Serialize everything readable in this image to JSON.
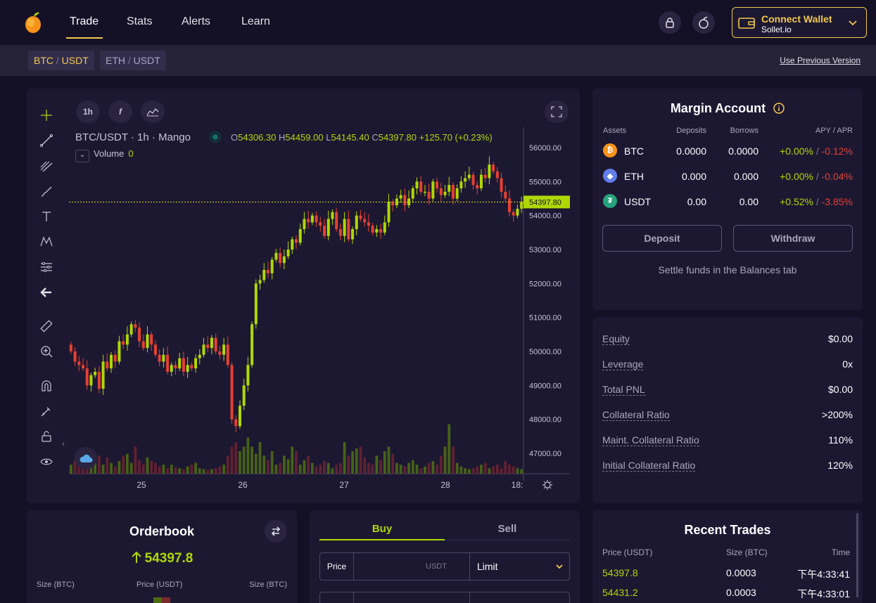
{
  "nav": {
    "items": [
      {
        "label": "Trade",
        "active": true
      },
      {
        "label": "Stats",
        "active": false
      },
      {
        "label": "Alerts",
        "active": false
      },
      {
        "label": "Learn",
        "active": false
      }
    ],
    "wallet": {
      "title": "Connect Wallet",
      "provider": "Sollet.io"
    }
  },
  "markets": {
    "tabs": [
      {
        "base": "BTC",
        "sep": "/",
        "quote": "USDT",
        "active": true
      },
      {
        "base": "ETH",
        "sep": "/",
        "quote": "USDT",
        "active": false
      }
    ],
    "previous_version": "Use Previous Version"
  },
  "chart": {
    "interval_chip": "1h",
    "fx_chip": "f",
    "header": "BTC/USDT · 1h · Mango",
    "ohlc": {
      "o_label": "O",
      "o": "54306.30",
      "h_label": "H",
      "h": "54459.00",
      "l_label": "L",
      "l": "54145.40",
      "c_label": "C",
      "c": "54397.80",
      "change": "+125.70 (+0.23%)"
    },
    "volume_label": "Volume",
    "volume_value": "0",
    "current_price_label": "54397.80",
    "colors": {
      "up": "#afd803",
      "down": "#e54033",
      "bg": "#1d1832"
    }
  },
  "chart_data": {
    "type": "candlestick",
    "x_ticks": [
      "25",
      "26",
      "27",
      "28",
      "18:"
    ],
    "y_ticks": [
      "56000.00",
      "55000.00",
      "54000.00",
      "53000.00",
      "52000.00",
      "51000.00",
      "50000.00",
      "49000.00",
      "48000.00",
      "47000.00"
    ],
    "ylim": [
      46400,
      56600
    ],
    "current_price": 54397.8,
    "closes": [
      50000,
      49700,
      49600,
      49500,
      49000,
      49300,
      49400,
      48900,
      49700,
      49500,
      49900,
      49700,
      50300,
      50200,
      50500,
      50800,
      50700,
      50300,
      50100,
      50500,
      50200,
      49900,
      49700,
      49900,
      49400,
      49600,
      49500,
      49800,
      49400,
      49600,
      49500,
      49800,
      49900,
      50200,
      50100,
      50400,
      50000,
      49900,
      50200,
      49600,
      48000,
      47800,
      48400,
      49000,
      49600,
      50800,
      52000,
      52100,
      52400,
      52300,
      52700,
      52900,
      52600,
      52800,
      53000,
      53300,
      53200,
      53600,
      53900,
      53800,
      54000,
      53800,
      53700,
      53400,
      53900,
      54100,
      53600,
      53400,
      53900,
      53300,
      53600,
      54000,
      53900,
      53800,
      53700,
      53500,
      53600,
      53500,
      53800,
      54400,
      54300,
      54500,
      54600,
      54300,
      54500,
      54800,
      55000,
      54700,
      54700,
      54500,
      55000,
      54800,
      54600,
      54700,
      54900,
      54500,
      54800,
      55000,
      55100,
      55200,
      54900,
      54800,
      55200,
      55100,
      55500,
      55300,
      55100,
      54700,
      54500,
      54100,
      54000,
      54200,
      54398
    ],
    "volumes": [
      0.1,
      0.15,
      0.2,
      0.12,
      0.08,
      0.1,
      0.15,
      0.2,
      0.1,
      0.18,
      0.12,
      0.08,
      0.14,
      0.2,
      0.22,
      0.12,
      0.3,
      0.15,
      0.1,
      0.18,
      0.14,
      0.12,
      0.08,
      0.1,
      0.06,
      0.1,
      0.07,
      0.06,
      0.05,
      0.08,
      0.1,
      0.12,
      0.06,
      0.05,
      0.04,
      0.05,
      0.06,
      0.08,
      0.1,
      0.2,
      0.3,
      0.35,
      0.25,
      0.3,
      0.4,
      0.3,
      0.22,
      0.35,
      0.2,
      0.15,
      0.25,
      0.1,
      0.12,
      0.2,
      0.16,
      0.3,
      0.25,
      0.1,
      0.15,
      0.2,
      0.12,
      0.08,
      0.1,
      0.14,
      0.12,
      0.06,
      0.1,
      0.12,
      0.35,
      0.2,
      0.25,
      0.28,
      0.3,
      0.18,
      0.12,
      0.1,
      0.2,
      0.15,
      0.25,
      0.3,
      0.22,
      0.12,
      0.1,
      0.08,
      0.12,
      0.15,
      0.1,
      0.06,
      0.08,
      0.12,
      0.14,
      0.1,
      0.2,
      0.3,
      0.55,
      0.3,
      0.12,
      0.08,
      0.06,
      0.05,
      0.06,
      0.08,
      0.1,
      0.12,
      0.06,
      0.08,
      0.1,
      0.06,
      0.14,
      0.1,
      0.08,
      0.06,
      0.05
    ]
  },
  "margin_account": {
    "title": "Margin Account",
    "headers": {
      "assets": "Assets",
      "deposits": "Deposits",
      "borrows": "Borrows",
      "apy": "APY / APR"
    },
    "rows": [
      {
        "asset": "BTC",
        "deposits": "0.0000",
        "borrows": "0.0000",
        "apy": "+0.00%",
        "apr": "-0.12%",
        "color": "#f7931a",
        "glyph": "₿"
      },
      {
        "asset": "ETH",
        "deposits": "0.000",
        "borrows": "0.000",
        "apy": "+0.00%",
        "apr": "-0.04%",
        "color": "#627eea",
        "glyph": "◆"
      },
      {
        "asset": "USDT",
        "deposits": "0.00",
        "borrows": "0.00",
        "apy": "+0.52%",
        "apr": "-3.85%",
        "color": "#26a17b",
        "glyph": "₮"
      }
    ],
    "deposit_label": "Deposit",
    "withdraw_label": "Withdraw",
    "settle_note": "Settle funds in the Balances tab"
  },
  "account_stats": [
    {
      "label": "Equity",
      "value": "$0.00"
    },
    {
      "label": "Leverage",
      "value": "0x"
    },
    {
      "label": "Total PNL",
      "value": "$0.00"
    },
    {
      "label": "Collateral Ratio",
      "value": ">200%"
    },
    {
      "label": "Maint. Collateral Ratio",
      "value": "110%"
    },
    {
      "label": "Initial Collateral Ratio",
      "value": "120%"
    }
  ],
  "orderbook": {
    "title": "Orderbook",
    "price": "54397.8",
    "headers": {
      "size_left": "Size (BTC)",
      "price": "Price (USDT)",
      "size_right": "Size (BTC)"
    }
  },
  "trade_form": {
    "buy_label": "Buy",
    "sell_label": "Sell",
    "price_label": "Price",
    "price_unit": "USDT",
    "order_type": "Limit"
  },
  "recent_trades": {
    "title": "Recent Trades",
    "headers": {
      "price": "Price (USDT)",
      "size": "Size (BTC)",
      "time": "Time"
    },
    "rows": [
      {
        "price": "54397.8",
        "size": "0.0003",
        "time": "下午4:33:41"
      },
      {
        "price": "54431.2",
        "size": "0.0003",
        "time": "下午4:33:01"
      }
    ]
  }
}
